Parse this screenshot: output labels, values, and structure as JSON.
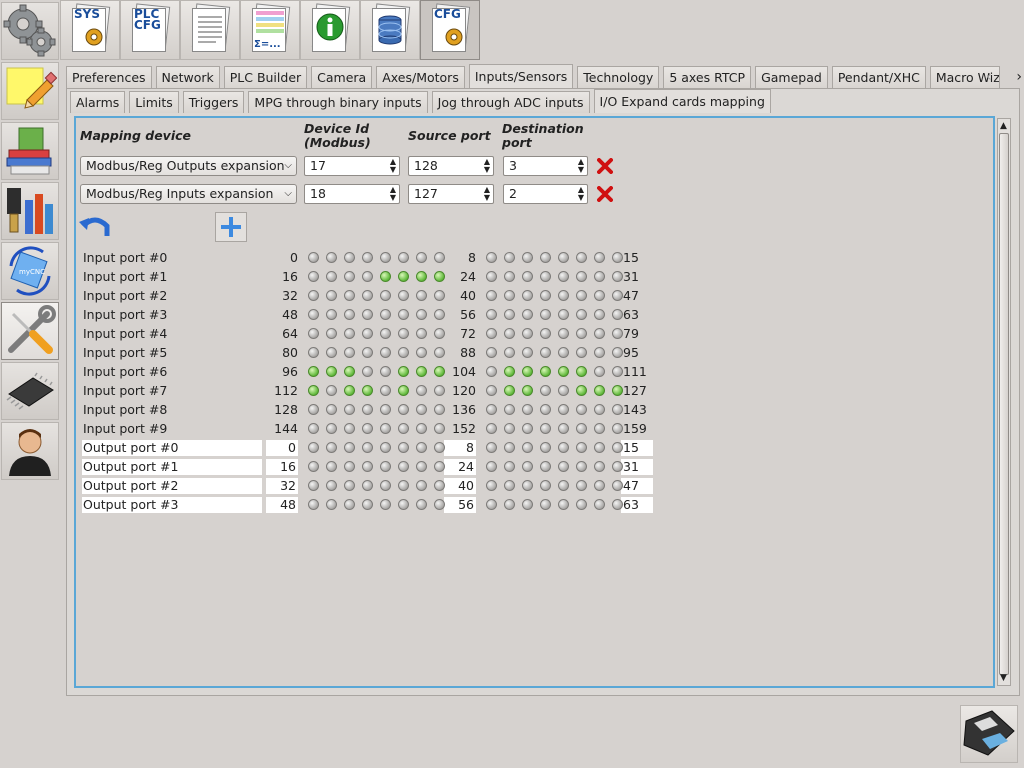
{
  "sidebar": {
    "items": [
      {
        "name": "settings-gears-icon"
      },
      {
        "name": "notes-pencil-icon"
      },
      {
        "name": "books-icon"
      },
      {
        "name": "tools-library-icon"
      },
      {
        "name": "mycnc-rotate-icon",
        "label": "myCNC"
      },
      {
        "name": "wrench-screwdriver-icon"
      },
      {
        "name": "chip-icon"
      },
      {
        "name": "user-icon"
      }
    ]
  },
  "toolbar": {
    "buttons": [
      {
        "label": "SYS"
      },
      {
        "label": "PLC\nCFG"
      },
      {
        "label": ""
      },
      {
        "label": "Σ=..."
      },
      {
        "label": ""
      },
      {
        "label": ""
      },
      {
        "label": "CFG"
      }
    ]
  },
  "main_tabs": [
    "Preferences",
    "Network",
    "PLC Builder",
    "Camera",
    "Axes/Motors",
    "Inputs/Sensors",
    "Technology",
    "5 axes RTCP",
    "Gamepad",
    "Pendant/XHC",
    "Macro Wiza"
  ],
  "sub_tabs": [
    "Alarms",
    "Limits",
    "Triggers",
    "MPG through binary inputs",
    "Jog through ADC inputs",
    "I/O Expand cards mapping"
  ],
  "headers": {
    "mapping_device": "Mapping device",
    "device_id_1": "Device Id",
    "device_id_2": "(Modbus)",
    "source_port": "Source port",
    "destination_port_1": "Destination",
    "destination_port_2": "port"
  },
  "mappings": [
    {
      "device": "Modbus/Reg Outputs expansion",
      "device_id": "17",
      "source_port": "128",
      "destination_port": "3"
    },
    {
      "device": "Modbus/Reg Inputs expansion",
      "device_id": "18",
      "source_port": "127",
      "destination_port": "2"
    }
  ],
  "ports": [
    {
      "label": "Input port #0",
      "start": "0",
      "mid": "8",
      "end": "15",
      "bits": "0000000000000000"
    },
    {
      "label": "Input port #1",
      "start": "16",
      "mid": "24",
      "end": "31",
      "bits": "0000111100000000"
    },
    {
      "label": "Input port #2",
      "start": "32",
      "mid": "40",
      "end": "47",
      "bits": "0000000000000000"
    },
    {
      "label": "Input port #3",
      "start": "48",
      "mid": "56",
      "end": "63",
      "bits": "0000000000000000"
    },
    {
      "label": "Input port #4",
      "start": "64",
      "mid": "72",
      "end": "79",
      "bits": "0000000000000000"
    },
    {
      "label": "Input port #5",
      "start": "80",
      "mid": "88",
      "end": "95",
      "bits": "0000000000000000"
    },
    {
      "label": "Input port #6",
      "start": "96",
      "mid": "104",
      "end": "111",
      "bits": "1110011101111100"
    },
    {
      "label": "Input port #7",
      "start": "112",
      "mid": "120",
      "end": "127",
      "bits": "1011010001100111"
    },
    {
      "label": "Input port #8",
      "start": "128",
      "mid": "136",
      "end": "143",
      "bits": "0000000000000000"
    },
    {
      "label": "Input port #9",
      "start": "144",
      "mid": "152",
      "end": "159",
      "bits": "0000000000000000"
    },
    {
      "label": "Output port #0",
      "start": "0",
      "mid": "8",
      "end": "15",
      "bits": "0000000000000000",
      "output": true
    },
    {
      "label": "Output port #1",
      "start": "16",
      "mid": "24",
      "end": "31",
      "bits": "0000000000000000",
      "output": true
    },
    {
      "label": "Output port #2",
      "start": "32",
      "mid": "40",
      "end": "47",
      "bits": "0000000000000000",
      "output": true
    },
    {
      "label": "Output port #3",
      "start": "48",
      "mid": "56",
      "end": "63",
      "bits": "0000000000000000",
      "output": true
    }
  ],
  "colors": {
    "accent": "#5aa7d6",
    "led_on": "#5fb83a",
    "led_off": "#a8a6a4",
    "delete": "#d01010"
  }
}
